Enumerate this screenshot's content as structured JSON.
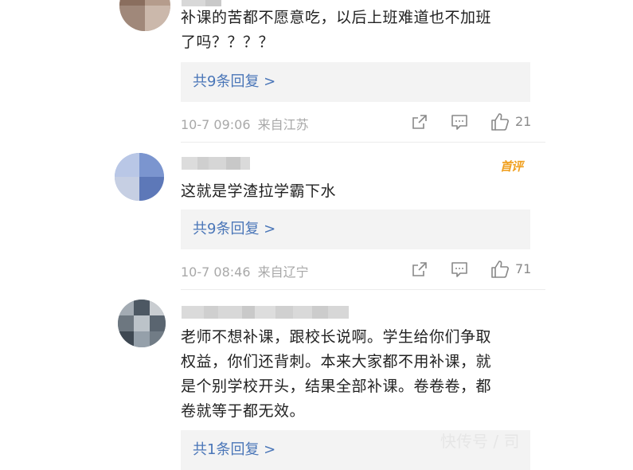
{
  "comments": [
    {
      "text_lines": [
        "补课的苦都不愿意吃，以后上班难道也不加班",
        "了吗？？？？"
      ],
      "replies_label": "共9条回复 >",
      "time": "10-7 09:06",
      "location": "来自江苏",
      "likes": "21"
    },
    {
      "badge": "首评",
      "text_lines": [
        "这就是学渣拉学霸下水"
      ],
      "replies_label": "共9条回复 >",
      "time": "10-7 08:46",
      "location": "来自辽宁",
      "likes": "71"
    },
    {
      "text_lines": [
        "老师不想补课，跟校长说啊。学生给你们争取",
        "权益，你们还背刺。本来大家都不用补课，就",
        "是个别学校开头，结果全部补课。卷卷卷，都",
        "卷就等于都无效。"
      ],
      "replies_label": "共1条回复 >"
    }
  ],
  "icons": {
    "share": "share-icon",
    "comment": "comment-icon",
    "like": "thumbs-up-icon"
  },
  "colors": {
    "link": "#4a76b8",
    "meta": "#a8a8a8",
    "badge": "#f0a020"
  },
  "watermark": "快传号 / 司"
}
